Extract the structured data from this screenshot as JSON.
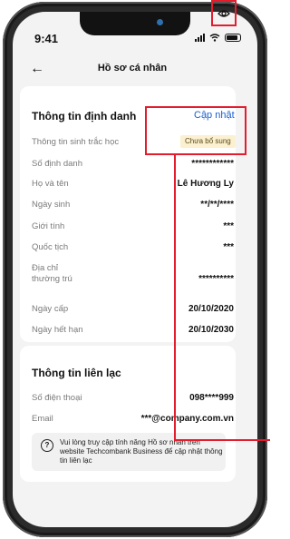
{
  "status": {
    "time": "9:41"
  },
  "header": {
    "title": "Hồ sơ cá nhân",
    "back_icon": "arrow-left-icon",
    "eye_icon": "eye-icon"
  },
  "identity": {
    "title": "Thông tin định danh",
    "update_label": "Cập nhật",
    "rows": [
      {
        "label": "Thông tin sinh trắc học",
        "value": "Chưa bổ sung"
      },
      {
        "label": "Số định danh",
        "value": "************"
      },
      {
        "label": "Họ và tên",
        "value": "Lê Hương Ly"
      },
      {
        "label": "Ngày sinh",
        "value": "**/**/****"
      },
      {
        "label": "Giới tính",
        "value": "***"
      },
      {
        "label": "Quốc tịch",
        "value": "***"
      },
      {
        "label": "Địa chỉ\nthường trú",
        "value": "**********"
      },
      {
        "label": "Ngày cấp",
        "value": "20/10/2020"
      },
      {
        "label": "Ngày hết hạn",
        "value": "20/10/2030"
      }
    ]
  },
  "contact": {
    "title": "Thông tin liên lạc",
    "rows": [
      {
        "label": "Số điện thoại",
        "value": "098****999"
      },
      {
        "label": "Email",
        "value": "***@company.com.vn"
      }
    ],
    "note": "Vui lòng truy cập tính năng Hồ sơ nhân trên website Techcombank Business để cập nhật thông tin liên lạc"
  },
  "colors": {
    "accent": "#1a5fd1",
    "highlight": "#e11d2e",
    "badge_bg": "#fbf0cf"
  }
}
